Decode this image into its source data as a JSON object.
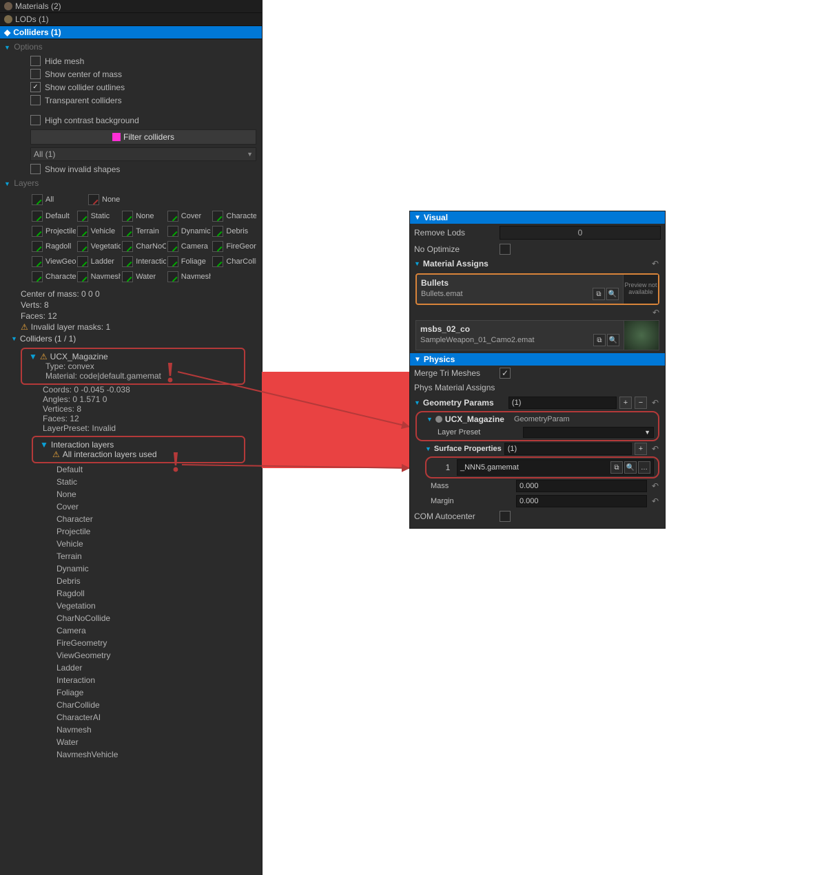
{
  "left": {
    "materials_header": "Materials (2)",
    "lods_header": "LODs (1)",
    "colliders_header": "Colliders (1)",
    "options": {
      "title": "Options",
      "hide_mesh": "Hide mesh",
      "show_com": "Show center of mass",
      "show_outlines": "Show collider outlines",
      "transparent": "Transparent colliders",
      "high_contrast": "High contrast background",
      "filter_btn": "Filter colliders",
      "all_dd": "All (1)",
      "show_invalid": "Show invalid shapes"
    },
    "layers": {
      "title": "Layers",
      "top": [
        "All",
        "",
        "None"
      ],
      "grid": [
        "Default",
        "Static",
        "None",
        "Cover",
        "Character",
        "Projectile",
        "Vehicle",
        "Terrain",
        "Dynamic",
        "Debris",
        "Ragdoll",
        "Vegetation",
        "CharNoCollide",
        "Camera",
        "FireGeometry",
        "ViewGeometry",
        "Ladder",
        "Interaction",
        "Foliage",
        "CharCollide",
        "CharacterAI",
        "Navmesh",
        "Water",
        "NavmeshVehicle"
      ]
    },
    "info": {
      "com": "Center of mass: 0 0 0",
      "verts": "Verts: 8",
      "faces": "Faces: 12",
      "invalid": "Invalid layer masks: 1"
    },
    "colliders_tree": {
      "title": "Colliders (1 / 1)",
      "ucx": {
        "name": "UCX_Magazine",
        "type": "Type: convex",
        "material": "Material: code|default.gamemat",
        "coords": "Coords: 0 -0.045 -0.038",
        "angles": "Angles: 0 1.571 0",
        "vertices": "Vertices: 8",
        "faces": "Faces: 12",
        "preset": "LayerPreset: Invalid"
      },
      "ilayers": {
        "title": "Interaction layers",
        "all_used": "All interaction layers used",
        "list": [
          "Default",
          "Static",
          "None",
          "Cover",
          "Character",
          "Projectile",
          "Vehicle",
          "Terrain",
          "Dynamic",
          "Debris",
          "Ragdoll",
          "Vegetation",
          "CharNoCollide",
          "Camera",
          "FireGeometry",
          "ViewGeometry",
          "Ladder",
          "Interaction",
          "Foliage",
          "CharCollide",
          "CharacterAI",
          "Navmesh",
          "Water",
          "NavmeshVehicle"
        ]
      }
    }
  },
  "right": {
    "visual": {
      "title": "Visual",
      "remove_lods": "Remove Lods",
      "remove_lods_val": "0",
      "no_optimize": "No Optimize",
      "mat_assigns": "Material Assigns",
      "bullets": {
        "name": "Bullets",
        "file": "Bullets.emat",
        "preview": "Preview not available"
      },
      "msbs": {
        "name": "msbs_02_co",
        "file": "SampleWeapon_01_Camo2.emat"
      }
    },
    "physics": {
      "title": "Physics",
      "merge": "Merge Tri Meshes",
      "pma": "Phys Material Assigns",
      "geoparams": "Geometry Params",
      "gp_count": "(1)",
      "ucx": "UCX_Magazine",
      "ucx_type": "GeometryParam",
      "layer_preset": "Layer Preset",
      "surface": "Surface Properties",
      "surf_count": "(1)",
      "surf1_label": "1",
      "surf1_file": "_NNN5.gamemat",
      "mass": "Mass",
      "mass_val": "0.000",
      "margin": "Margin",
      "margin_val": "0.000",
      "com_auto": "COM Autocenter"
    }
  }
}
